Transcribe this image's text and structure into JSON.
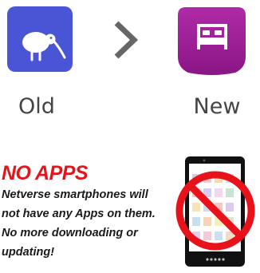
{
  "comparison": {
    "old_label": "Old",
    "new_label": "New",
    "old_icon": "kiwi-bird-icon",
    "new_icon": "bed-icon",
    "arrow_icon": "chevron-right-icon",
    "old_color": "#4a55d6",
    "new_color": "#a21d9a"
  },
  "feature": {
    "title": "NO APPS",
    "lines": [
      "Netverse smartphones will",
      "not have any Apps on them.",
      "No more downloading or",
      "updating!"
    ],
    "illustration": "no-apps-phone-icon",
    "title_color": "#e8121b"
  }
}
